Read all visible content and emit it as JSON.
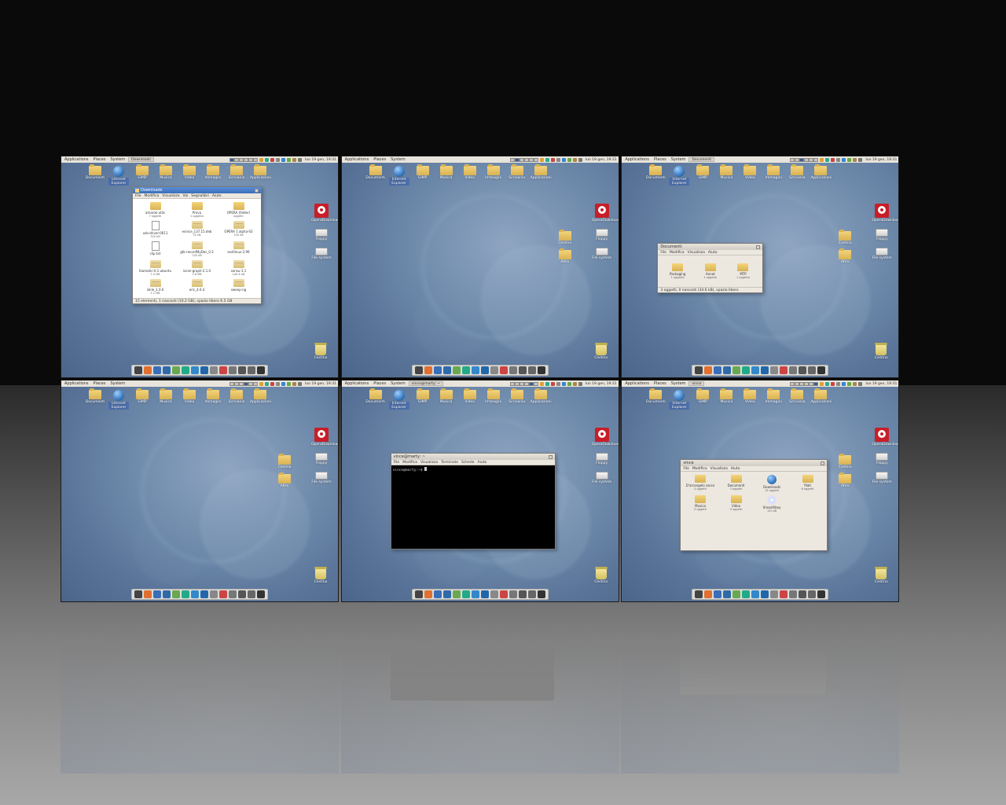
{
  "panel": {
    "menus": [
      "Applications",
      "Places",
      "System"
    ],
    "clock": "lun 19 gen, 19:31"
  },
  "taskbar": {
    "ws1": "Downloads",
    "ws3": "Documenti",
    "ws5": "vince@marty: ~",
    "ws6": "vince"
  },
  "desktop_icons": [
    {
      "label": "Documenti",
      "type": "folder"
    },
    {
      "label": "Internet Explorer",
      "type": "globe",
      "selected": true
    },
    {
      "label": "GIMP",
      "type": "folder"
    },
    {
      "label": "Musica",
      "type": "folder"
    },
    {
      "label": "Video",
      "type": "folder"
    },
    {
      "label": "Immagini",
      "type": "folder"
    },
    {
      "label": "Scrivania",
      "type": "folder"
    },
    {
      "label": "Applicazioni",
      "type": "folder"
    }
  ],
  "right_icons": [
    {
      "label": "OperaDownloads",
      "type": "app-badge"
    },
    {
      "label": "Floppy",
      "type": "drive"
    },
    {
      "label": "File system",
      "type": "drive"
    }
  ],
  "mid_icons": [
    {
      "label": "Cestino",
      "type": "folder"
    },
    {
      "label": "Altro",
      "type": "folder"
    }
  ],
  "trash_label": "Cestino",
  "window_downloads": {
    "title": "Downloads",
    "toolbar": [
      "File",
      "Modifica",
      "Visualizza",
      "Vai",
      "Segnalibri",
      "Aiuto"
    ],
    "status": "15 elementi, 1 nascosti (10.2 GB), spazio libero 6.5 GB",
    "files": [
      {
        "name": "amarok-utils",
        "meta": "7 oggetti",
        "icon": "folder-mini"
      },
      {
        "name": "Prova",
        "meta": "1 oggetto",
        "icon": "folder-mini"
      },
      {
        "name": "OPERA (folder)",
        "meta": "oggetti",
        "icon": "folder-mini"
      },
      {
        "name": "usb-driver-0611",
        "meta": "320 kB",
        "icon": "docicon"
      },
      {
        "name": "evince_137.15.deb",
        "meta": "52 kB",
        "icon": "box"
      },
      {
        "name": "OPERA 1 alpha-03",
        "meta": "100 kB",
        "icon": "box"
      },
      {
        "name": "clip.txt",
        "meta": "",
        "icon": "docicon"
      },
      {
        "name": "gtk-recordMyDes_0.3",
        "meta": "100 kB",
        "icon": "box"
      },
      {
        "name": "ies4linux-2.99",
        "meta": "",
        "icon": "box"
      },
      {
        "name": "foomatic-0.1-ubuntu",
        "meta": "1.0 MB",
        "icon": "box"
      },
      {
        "name": "iscan-graph-2.1.0",
        "meta": "1.8 MB",
        "icon": "box"
      },
      {
        "name": "sensu-1.1",
        "meta": "140.6 kB",
        "icon": "box"
      },
      {
        "name": "inkle_1.0.0",
        "meta": "1.1 MB",
        "icon": "box"
      },
      {
        "name": "eric_4.0.4",
        "meta": "",
        "icon": "box"
      },
      {
        "name": "sweep-ng",
        "meta": "",
        "icon": "box"
      }
    ]
  },
  "window_documents": {
    "title": "Documenti",
    "toolbar": [
      "File",
      "Modifica",
      "Visualizza",
      "Aiuto"
    ],
    "status": "3 oggetti, 0 nascosti (34.6 kB), spazio libero",
    "files": [
      {
        "name": "Packaging",
        "meta": "1 oggetto",
        "icon": "folder-mini"
      },
      {
        "name": "Annot",
        "meta": "1 oggetto",
        "icon": "folder-mini"
      },
      {
        "name": "MTP",
        "meta": "1 oggetto",
        "icon": "folder-mini"
      }
    ]
  },
  "window_terminal": {
    "title": "vince@marty: ~",
    "menu": [
      "File",
      "Modifica",
      "Visualizza",
      "Terminale",
      "Schede",
      "Aiuto"
    ],
    "prompt": "vince@marty:~$ "
  },
  "window_home": {
    "title": "vince",
    "toolbar": [
      "File",
      "Modifica",
      "Visualizza",
      "Aiuto"
    ],
    "status": "",
    "files": [
      {
        "name": "D'arcangelo sacco",
        "meta": "4 oggetti",
        "icon": "folder-mini"
      },
      {
        "name": "Documenti",
        "meta": "3 oggetti",
        "icon": "folder-mini"
      },
      {
        "name": "Downloads",
        "meta": "15 oggetti",
        "icon": "globe-mini"
      },
      {
        "name": "filati",
        "meta": "6 oggetti",
        "icon": "folder-mini"
      },
      {
        "name": "Musica",
        "meta": "0 oggetti",
        "icon": "folder-mini"
      },
      {
        "name": "Video",
        "meta": "0 oggetti",
        "icon": "folder-mini"
      },
      {
        "name": "Smoothboy",
        "meta": "120 kB",
        "icon": "disk"
      }
    ]
  },
  "dock_icons": [
    "#444",
    "#e07030",
    "#3a6eb8",
    "#2e6aa8",
    "#6aa84f",
    "#2a8",
    "#38c",
    "#26a",
    "#888",
    "#c44",
    "#777",
    "#555",
    "#666",
    "#333"
  ],
  "tray_icons": [
    "#e0a030",
    "#3a8",
    "#c44",
    "#888",
    "#38c",
    "#6a4",
    "#a84",
    "#777"
  ]
}
